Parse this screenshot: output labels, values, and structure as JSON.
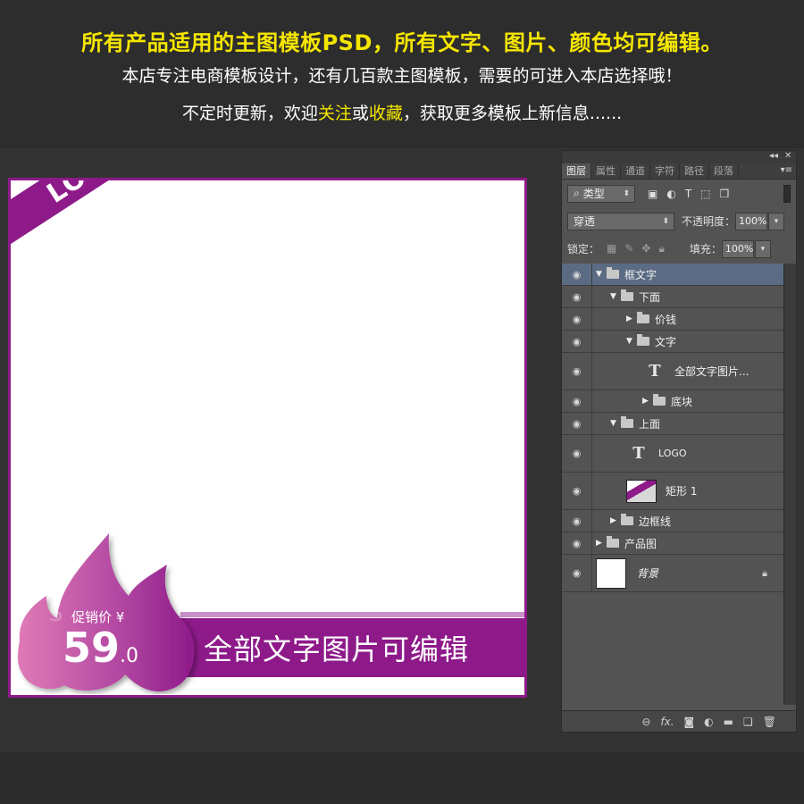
{
  "header": {
    "line1": "所有产品适用的主图模板PSD，所有文字、图片、颜色均可编辑。",
    "line2": "本店专注电商模板设计，还有几百款主图模板，需要的可进入本店选择哦！",
    "line3_pre": "不定时更新，欢迎",
    "line3_hl1": "关注",
    "line3_mid": "或",
    "line3_hl2": "收藏",
    "line3_post": "，获取更多模板上新信息......"
  },
  "canvas": {
    "logo": "LOGO",
    "price_label": "促销价 ¥",
    "price_int": "59",
    "price_dec": ".0",
    "banner_text": "全部文字图片可编辑",
    "accent_color": "#8e1a8a"
  },
  "panel": {
    "tabs": [
      "图层",
      "属性",
      "通道",
      "字符",
      "路径",
      "段落"
    ],
    "filter_label": "类型",
    "blend_mode": "穿透",
    "opacity_label": "不透明度：",
    "opacity_value": "100%",
    "lock_label": "锁定：",
    "fill_label": "填充：",
    "fill_value": "100%",
    "layers": [
      {
        "name": "框文字"
      },
      {
        "name": "下面"
      },
      {
        "name": "价钱"
      },
      {
        "name": "文字"
      },
      {
        "name": "全部文字图片..."
      },
      {
        "name": "底块"
      },
      {
        "name": "上面"
      },
      {
        "name": "LOGO"
      },
      {
        "name": "矩形 1"
      },
      {
        "name": "边框线"
      },
      {
        "name": "产品图"
      },
      {
        "name": "背景"
      }
    ]
  }
}
